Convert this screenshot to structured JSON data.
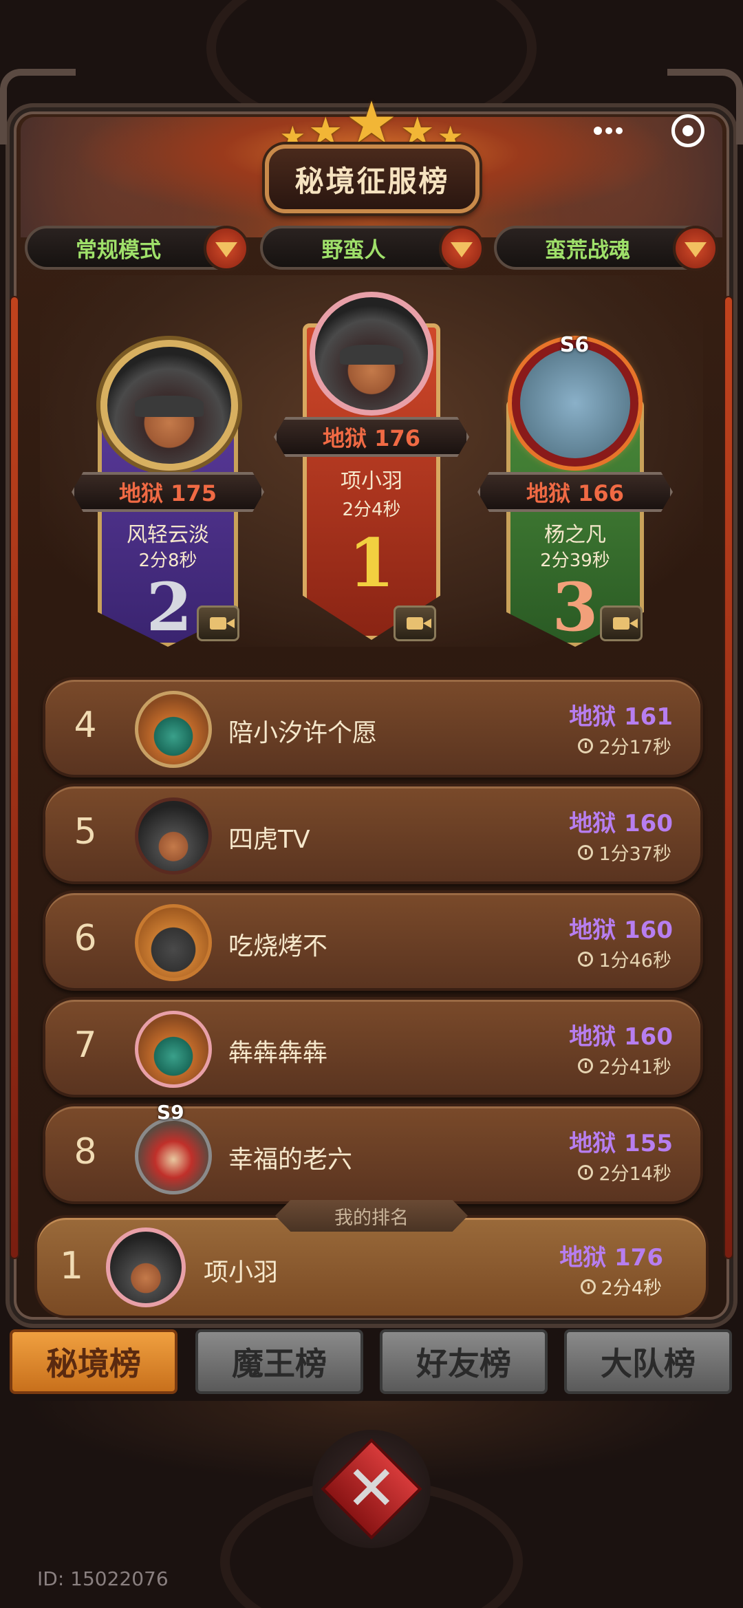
{
  "header": {
    "title": "秘境征服榜"
  },
  "filters": [
    {
      "label": "常规模式"
    },
    {
      "label": "野蛮人"
    },
    {
      "label": "蛮荒战魂"
    }
  ],
  "podium": [
    {
      "place": "2",
      "rank": "地狱 175",
      "name": "风轻云淡",
      "time": "2分8秒"
    },
    {
      "place": "1",
      "rank": "地狱 176",
      "name": "项小羽",
      "time": "2分4秒"
    },
    {
      "place": "3",
      "rank": "地狱 166",
      "name": "杨之凡",
      "time": "2分39秒",
      "season": "S6"
    }
  ],
  "list": [
    {
      "num": "4",
      "name": "陪小汐许个愿",
      "rank": "地狱 161",
      "time": "2分17秒"
    },
    {
      "num": "5",
      "name": "四虎TV",
      "rank": "地狱 160",
      "time": "1分37秒"
    },
    {
      "num": "6",
      "name": "吃烧烤不",
      "rank": "地狱 160",
      "time": "1分46秒"
    },
    {
      "num": "7",
      "name": "犇犇犇犇",
      "rank": "地狱 160",
      "time": "2分41秒"
    },
    {
      "num": "8",
      "name": "幸福的老六",
      "rank": "地狱 155",
      "time": "2分14秒",
      "season": "S9"
    }
  ],
  "my_rank": {
    "label": "我的排名",
    "num": "1",
    "name": "项小羽",
    "rank": "地狱 176",
    "time": "2分4秒"
  },
  "tabs": [
    {
      "label": "秘境榜",
      "active": true
    },
    {
      "label": "魔王榜",
      "active": false
    },
    {
      "label": "好友榜",
      "active": false
    },
    {
      "label": "大队榜",
      "active": false
    }
  ],
  "footer": {
    "id": "ID: 15022076"
  },
  "colors": {
    "accent_purple": "#b77ef0",
    "hell_red": "#f06a44",
    "filter_green": "#9fe06a",
    "tab_active": "#f0a040"
  }
}
